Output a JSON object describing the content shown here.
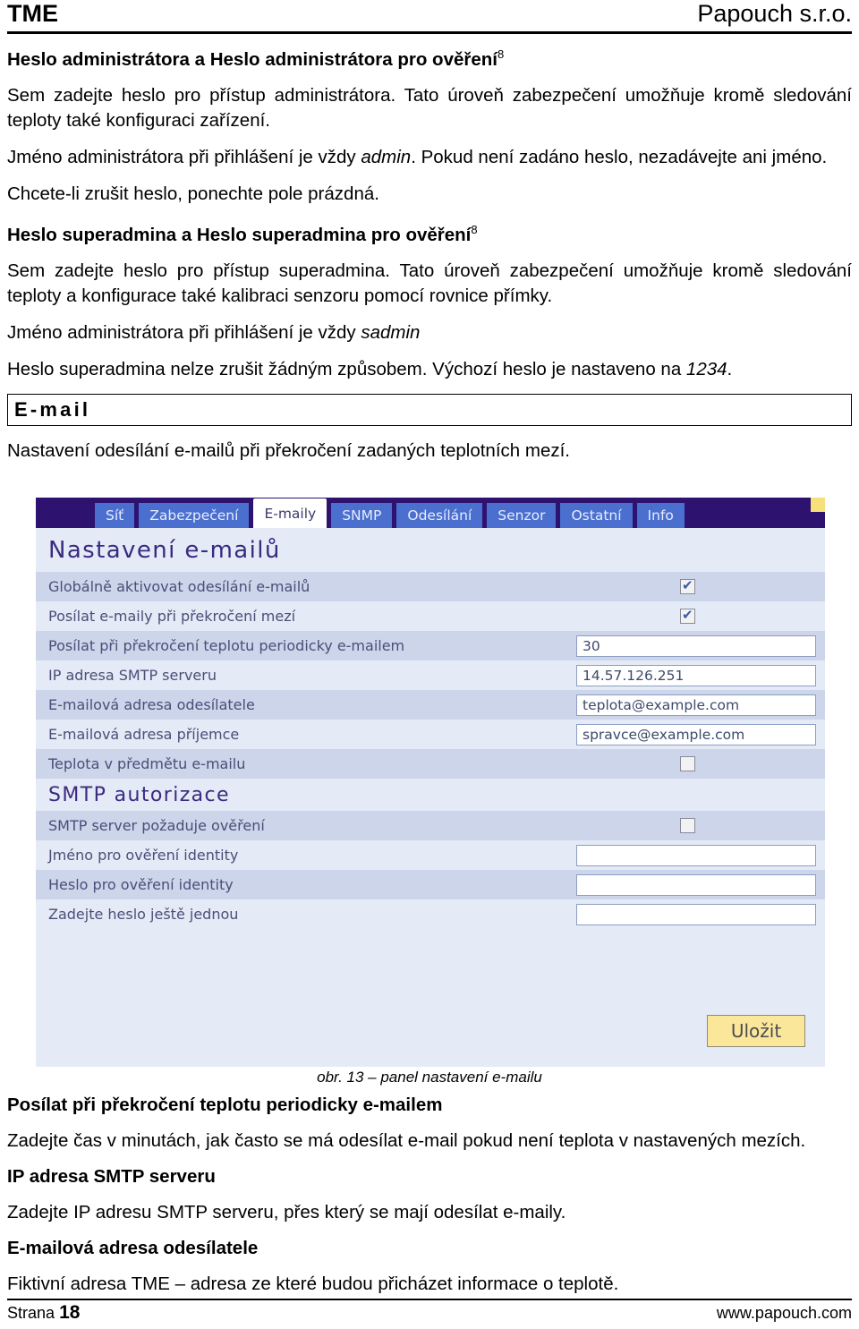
{
  "header": {
    "left_title": "TME",
    "right_title": "Papouch s.r.o."
  },
  "body": {
    "admin_heading_part1": "Heslo administrátora",
    "admin_heading_conj": " a ",
    "admin_heading_part2": "Heslo administrátora pro ověření",
    "admin_heading_footnote": "8",
    "admin_p1": "Sem zadejte heslo pro přístup administrátora. Tato úroveň zabezpečení umožňuje kromě sledování teploty také konfiguraci zařízení.",
    "admin_p2_a": "Jméno administrátora při přihlášení je vždy ",
    "admin_p2_em": "admin",
    "admin_p2_b": ". Pokud není zadáno heslo, nezadávejte ani jméno.",
    "admin_p3": "Chcete-li zrušit heslo, ponechte pole prázdná.",
    "super_heading_part1": "Heslo superadmina",
    "super_heading_conj": " a ",
    "super_heading_part2": "Heslo superadmina pro ověření",
    "super_heading_footnote": "8",
    "super_p1": "Sem zadejte heslo pro přístup superadmina. Tato úroveň zabezpečení umožňuje kromě sledování teploty a konfigurace také kalibraci senzoru pomocí rovnice přímky.",
    "super_p2_a": "Jméno administrátora při přihlášení je vždy ",
    "super_p2_em": "sadmin",
    "super_p3_a": "Heslo superadmina nelze zrušit žádným způsobem. Výchozí heslo je nastaveno na ",
    "super_p3_em": "1234",
    "super_p3_b": "."
  },
  "email_section": {
    "box_title": "E-mail",
    "intro": "Nastavení odesílání e-mailů při překročení zadaných teplotních mezí."
  },
  "screenshot": {
    "tabs": [
      {
        "label": "Síť",
        "active": false
      },
      {
        "label": "Zabezpečení",
        "active": false
      },
      {
        "label": "E-maily",
        "active": true
      },
      {
        "label": "SNMP",
        "active": false
      },
      {
        "label": "Odesílání",
        "active": false
      },
      {
        "label": "Senzor",
        "active": false
      },
      {
        "label": "Ostatní",
        "active": false
      },
      {
        "label": "Info",
        "active": false
      }
    ],
    "panel_title": "Nastavení e-mailů",
    "rows": [
      {
        "label": "Globálně aktivovat odesílání e-mailů",
        "type": "checkbox",
        "checked": true
      },
      {
        "label": "Posílat e-maily při překročení mezí",
        "type": "checkbox",
        "checked": true
      },
      {
        "label": "Posílat při překročení teplotu periodicky e-mailem",
        "type": "input",
        "value": "30"
      },
      {
        "label": "IP adresa SMTP serveru",
        "type": "input",
        "value": "14.57.126.251"
      },
      {
        "label": "E-mailová adresa odesílatele",
        "type": "input",
        "value": "teplota@example.com"
      },
      {
        "label": "E-mailová adresa příjemce",
        "type": "input",
        "value": "spravce@example.com"
      },
      {
        "label": "Teplota v předmětu e-mailu",
        "type": "checkbox",
        "checked": false
      }
    ],
    "smtp_title": "SMTP autorizace",
    "smtp_rows": [
      {
        "label": "SMTP server požaduje ověření",
        "type": "checkbox",
        "checked": false
      },
      {
        "label": "Jméno pro ověření identity",
        "type": "input",
        "value": ""
      },
      {
        "label": "Heslo pro ověření identity",
        "type": "input",
        "value": ""
      },
      {
        "label": "Zadejte heslo ještě jednou",
        "type": "input",
        "value": ""
      }
    ],
    "save_label": "Uložit",
    "colors": {
      "tabbar": "#2e1270",
      "tab": "#4a6fcf",
      "panel_bg": "#e4eaf6",
      "row_alt": "#ccd5ea",
      "title": "#3b2a80",
      "save_bg": "#fbe79a",
      "corner_accent": "#f5e07a"
    }
  },
  "figure_caption": "obr. 13 – panel nastavení e-mailu",
  "bottom": {
    "h1": "Posílat při překročení teplotu periodicky e-mailem",
    "p1": "Zadejte čas v minutách, jak často se má odesílat e-mail pokud není teplota v nastavených mezích.",
    "h2": "IP adresa SMTP serveru",
    "p2": "Zadejte IP adresu SMTP serveru, přes který se mají odesílat e-maily.",
    "h3": "E-mailová adresa odesílatele",
    "p3": "Fiktivní adresa TME – adresa ze které budou přicházet informace o teplotě."
  },
  "footer": {
    "page_word": "Strana",
    "page_number": "18",
    "url": "www.papouch.com"
  }
}
